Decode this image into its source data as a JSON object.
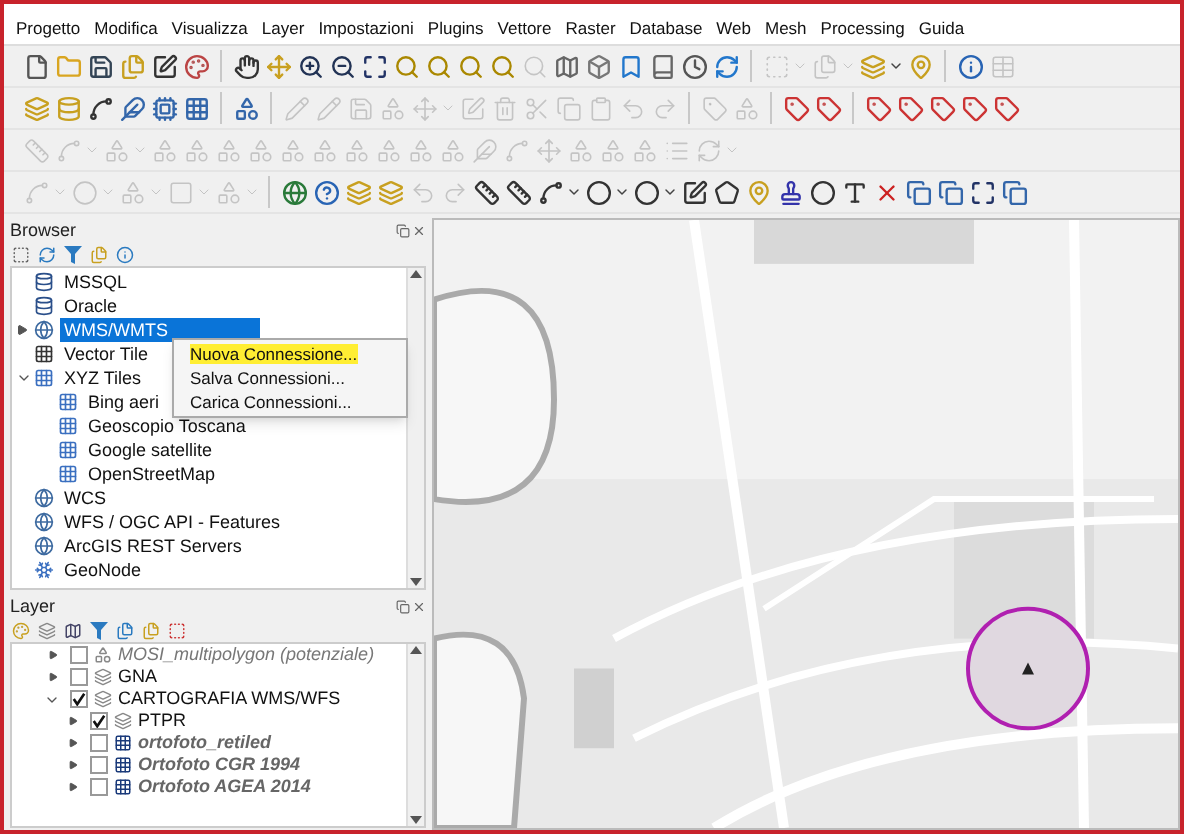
{
  "menu_bar": [
    "Progetto",
    "Modifica",
    "Visualizza",
    "Layer",
    "Impostazioni",
    "Plugins",
    "Vettore",
    "Raster",
    "Database",
    "Web",
    "Mesh",
    "Processing",
    "Guida"
  ],
  "toolbars": [
    [
      {
        "kind": "file",
        "disabled": false
      },
      {
        "kind": "folder",
        "disabled": false
      },
      {
        "kind": "save",
        "disabled": false
      },
      {
        "kind": "files",
        "disabled": false
      },
      {
        "kind": "edit",
        "disabled": false
      },
      {
        "kind": "palette",
        "disabled": false
      },
      {
        "kind": "sep"
      },
      {
        "kind": "hand",
        "disabled": false
      },
      {
        "kind": "move",
        "disabled": false
      },
      {
        "kind": "zoom-in",
        "disabled": false
      },
      {
        "kind": "zoom-out",
        "disabled": false
      },
      {
        "kind": "maximize",
        "disabled": false
      },
      {
        "kind": "search",
        "disabled": false
      },
      {
        "kind": "search",
        "disabled": false
      },
      {
        "kind": "search",
        "disabled": false
      },
      {
        "kind": "search",
        "disabled": false
      },
      {
        "kind": "search",
        "disabled": true
      },
      {
        "kind": "map",
        "disabled": false
      },
      {
        "kind": "box",
        "disabled": false
      },
      {
        "kind": "bookmark",
        "disabled": false
      },
      {
        "kind": "book",
        "disabled": false
      },
      {
        "kind": "clock",
        "disabled": false
      },
      {
        "kind": "refresh",
        "disabled": false
      },
      {
        "kind": "sep"
      },
      {
        "kind": "select",
        "disabled": true
      },
      {
        "kind": "caret",
        "disabled": true
      },
      {
        "kind": "files",
        "disabled": true
      },
      {
        "kind": "caret",
        "disabled": true
      },
      {
        "kind": "layers",
        "disabled": false
      },
      {
        "kind": "caret",
        "disabled": false
      },
      {
        "kind": "pin",
        "disabled": false
      },
      {
        "kind": "sep"
      },
      {
        "kind": "info",
        "disabled": false
      },
      {
        "kind": "table",
        "disabled": true
      }
    ],
    [
      {
        "kind": "layers",
        "disabled": false
      },
      {
        "kind": "database",
        "disabled": false
      },
      {
        "kind": "spline",
        "disabled": false
      },
      {
        "kind": "feather",
        "disabled": false
      },
      {
        "kind": "cpu",
        "disabled": false
      },
      {
        "kind": "grid",
        "disabled": false
      },
      {
        "kind": "sep"
      },
      {
        "kind": "shapes",
        "disabled": false
      },
      {
        "kind": "sep"
      },
      {
        "kind": "pencil",
        "disabled": true
      },
      {
        "kind": "pencil",
        "disabled": true
      },
      {
        "kind": "save",
        "disabled": true
      },
      {
        "kind": "shapes",
        "disabled": true
      },
      {
        "kind": "move",
        "disabled": true
      },
      {
        "kind": "caret",
        "disabled": true
      },
      {
        "kind": "edit",
        "disabled": true
      },
      {
        "kind": "trash",
        "disabled": true
      },
      {
        "kind": "scissors",
        "disabled": true
      },
      {
        "kind": "copy",
        "disabled": true
      },
      {
        "kind": "clipboard",
        "disabled": true
      },
      {
        "kind": "undo",
        "disabled": true
      },
      {
        "kind": "redo",
        "disabled": true
      },
      {
        "kind": "sep"
      },
      {
        "kind": "tag",
        "disabled": true
      },
      {
        "kind": "shapes",
        "disabled": true
      },
      {
        "kind": "sep"
      },
      {
        "kind": "tag",
        "disabled": false
      },
      {
        "kind": "tag",
        "disabled": false
      },
      {
        "kind": "sep"
      },
      {
        "kind": "tag",
        "disabled": false
      },
      {
        "kind": "tag",
        "disabled": false
      },
      {
        "kind": "tag",
        "disabled": false
      },
      {
        "kind": "tag",
        "disabled": false
      },
      {
        "kind": "tag",
        "disabled": false
      }
    ],
    [
      {
        "kind": "ruler",
        "disabled": true
      },
      {
        "kind": "spline",
        "disabled": true
      },
      {
        "kind": "caret",
        "disabled": true
      },
      {
        "kind": "shapes",
        "disabled": true
      },
      {
        "kind": "caret",
        "disabled": true
      },
      {
        "kind": "shapes",
        "disabled": true
      },
      {
        "kind": "shapes",
        "disabled": true
      },
      {
        "kind": "shapes",
        "disabled": true
      },
      {
        "kind": "shapes",
        "disabled": true
      },
      {
        "kind": "shapes",
        "disabled": true
      },
      {
        "kind": "shapes",
        "disabled": true
      },
      {
        "kind": "shapes",
        "disabled": true
      },
      {
        "kind": "shapes",
        "disabled": true
      },
      {
        "kind": "shapes",
        "disabled": true
      },
      {
        "kind": "shapes",
        "disabled": true
      },
      {
        "kind": "feather",
        "disabled": true
      },
      {
        "kind": "spline",
        "disabled": true
      },
      {
        "kind": "move",
        "disabled": true
      },
      {
        "kind": "shapes",
        "disabled": true
      },
      {
        "kind": "shapes",
        "disabled": true
      },
      {
        "kind": "shapes",
        "disabled": true
      },
      {
        "kind": "list",
        "disabled": true
      },
      {
        "kind": "refresh",
        "disabled": true
      },
      {
        "kind": "caret",
        "disabled": true
      }
    ],
    [
      {
        "kind": "spline",
        "disabled": true
      },
      {
        "kind": "caret",
        "disabled": true
      },
      {
        "kind": "circle",
        "disabled": true
      },
      {
        "kind": "caret",
        "disabled": true
      },
      {
        "kind": "shapes",
        "disabled": true
      },
      {
        "kind": "caret",
        "disabled": true
      },
      {
        "kind": "square",
        "disabled": true
      },
      {
        "kind": "caret",
        "disabled": true
      },
      {
        "kind": "shapes",
        "disabled": true
      },
      {
        "kind": "caret",
        "disabled": true
      },
      {
        "kind": "sep"
      },
      {
        "kind": "globe",
        "disabled": false
      },
      {
        "kind": "help",
        "disabled": false
      },
      {
        "kind": "layers",
        "disabled": false
      },
      {
        "kind": "layers",
        "disabled": false
      },
      {
        "kind": "undo",
        "disabled": true
      },
      {
        "kind": "redo",
        "disabled": true
      },
      {
        "kind": "ruler",
        "disabled": false
      },
      {
        "kind": "ruler",
        "disabled": false
      },
      {
        "kind": "spline",
        "disabled": false
      },
      {
        "kind": "caret",
        "disabled": false
      },
      {
        "kind": "circle",
        "disabled": false
      },
      {
        "kind": "caret",
        "disabled": false
      },
      {
        "kind": "circle",
        "disabled": false
      },
      {
        "kind": "caret",
        "disabled": false
      },
      {
        "kind": "edit",
        "disabled": false
      },
      {
        "kind": "pentagon",
        "disabled": false
      },
      {
        "kind": "pin",
        "disabled": false
      },
      {
        "kind": "stamp",
        "disabled": false
      },
      {
        "kind": "circle",
        "disabled": false
      },
      {
        "kind": "type",
        "disabled": false
      },
      {
        "kind": "x",
        "disabled": false
      },
      {
        "kind": "copy",
        "disabled": false
      },
      {
        "kind": "copy",
        "disabled": false
      },
      {
        "kind": "maximize",
        "disabled": false
      },
      {
        "kind": "copy",
        "disabled": false
      }
    ]
  ],
  "browser": {
    "title": "Browser",
    "items": [
      {
        "label": "MSSQL",
        "kind": "db",
        "selected": false
      },
      {
        "label": "Oracle",
        "kind": "db",
        "selected": false
      },
      {
        "label": "WMS/WMTS",
        "kind": "globe",
        "expanded": false,
        "selected": true
      },
      {
        "label": "Vector Tile",
        "kind": "grid",
        "selected": false
      },
      {
        "label": "XYZ Tiles",
        "kind": "tiles",
        "expanded": true,
        "selected": false,
        "children": [
          {
            "label": "Bing aeri",
            "kind": "tiles",
            "selected": false
          },
          {
            "label": "Geoscopio Toscana",
            "kind": "tiles",
            "selected": false
          },
          {
            "label": "Google satellite",
            "kind": "tiles",
            "selected": false
          },
          {
            "label": "OpenStreetMap",
            "kind": "tiles",
            "selected": false
          }
        ]
      },
      {
        "label": "WCS",
        "kind": "globe",
        "selected": false
      },
      {
        "label": "WFS / OGC API - Features",
        "kind": "globe",
        "selected": false
      },
      {
        "label": "ArcGIS REST Servers",
        "kind": "globe",
        "selected": false
      },
      {
        "label": "GeoNode",
        "kind": "snow",
        "selected": false
      }
    ],
    "context_menu": [
      {
        "label": "Nuova Connessione...",
        "selected": true
      },
      {
        "label": "Salva Connessioni...",
        "selected": false
      },
      {
        "label": "Carica Connessioni...",
        "selected": false
      }
    ]
  },
  "layers": {
    "title": "Layer",
    "items": [
      {
        "label": "MOSI_multipolygon (potenziale)",
        "kind": "vector",
        "checked": false,
        "expanded": false
      },
      {
        "label": "GNA",
        "kind": "group",
        "checked": false,
        "expanded": false
      },
      {
        "label": "CARTOGRAFIA WMS/WFS",
        "kind": "group",
        "checked": true,
        "expanded": true,
        "children": [
          {
            "label": "PTPR",
            "kind": "group",
            "checked": true,
            "expanded": false
          },
          {
            "label": "ortofoto_retiled",
            "kind": "raster",
            "checked": false,
            "expanded": false
          },
          {
            "label": "Ortofoto CGR 1994",
            "kind": "raster",
            "checked": false,
            "expanded": false
          },
          {
            "label": "Ortofoto AGEA 2014",
            "kind": "raster",
            "checked": false,
            "expanded": false
          }
        ]
      }
    ]
  }
}
